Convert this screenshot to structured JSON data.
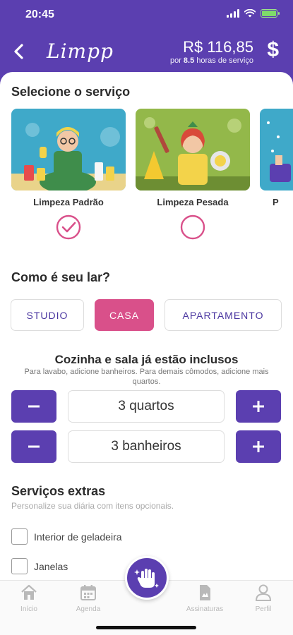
{
  "status_bar": {
    "time": "20:45"
  },
  "header": {
    "logo": "Limpp",
    "price": "R$ 116,85",
    "price_sub_prefix": "por",
    "hours": "8.5",
    "price_sub_suffix": "horas de serviço",
    "currency_icon": "$"
  },
  "service_section": {
    "title": "Selecione o serviço",
    "services": [
      {
        "label": "Limpeza Padrão",
        "selected": true
      },
      {
        "label": "Limpeza Pesada",
        "selected": false
      },
      {
        "label": "P",
        "selected": false
      }
    ]
  },
  "home_section": {
    "title": "Como é seu lar?",
    "options": [
      "STUDIO",
      "CASA",
      "APARTAMENTO"
    ],
    "selected": "CASA"
  },
  "rooms": {
    "title": "Cozinha e sala já estão inclusos",
    "subtitle": "Para lavabo, adicione banheiros. Para demais cômodos, adicione mais quartos.",
    "bedrooms": "3 quartos",
    "bathrooms": "3 banheiros"
  },
  "extras": {
    "title": "Serviços extras",
    "subtitle": "Personalize sua diária com itens opcionais.",
    "items": [
      {
        "label": "Interior de geladeira",
        "checked": false
      },
      {
        "label": "Janelas",
        "checked": false
      }
    ]
  },
  "bottom_nav": {
    "items": [
      "Início",
      "Agenda",
      "Assinaturas",
      "Perfil"
    ]
  },
  "colors": {
    "brand": "#5b3fb0",
    "accent": "#d9508a"
  }
}
